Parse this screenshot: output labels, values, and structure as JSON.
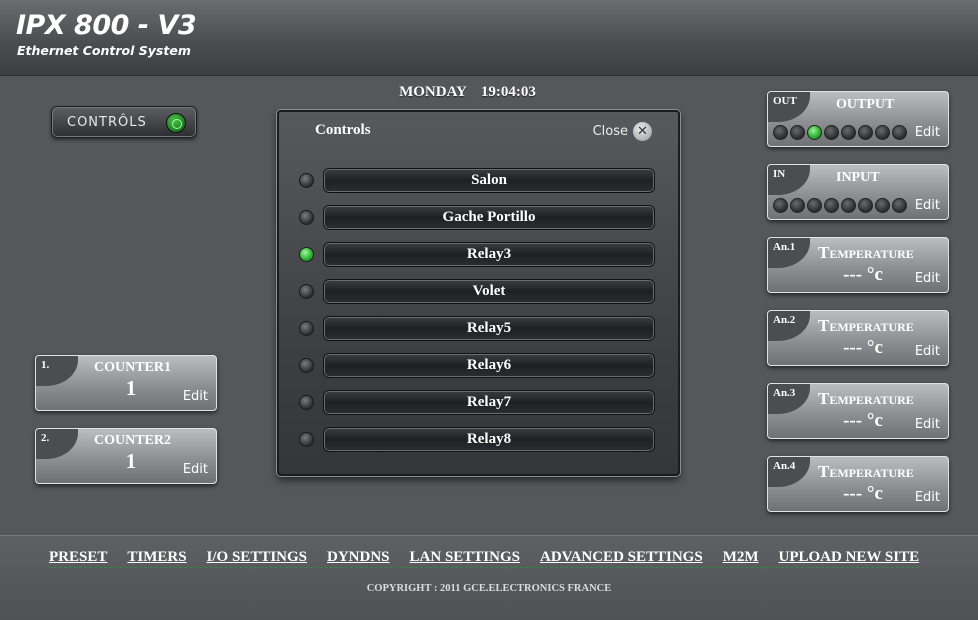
{
  "header": {
    "title": "IPX 800 - V3",
    "subtitle": "Ethernet Control System"
  },
  "datetime": {
    "day": "MONDAY",
    "time": "19:04:03"
  },
  "controls_button": {
    "label": "CONTRÔLS"
  },
  "counters": [
    {
      "index": "1.",
      "name": "COUNTER1",
      "value": "1",
      "edit": "Edit"
    },
    {
      "index": "2.",
      "name": "COUNTER2",
      "value": "1",
      "edit": "Edit"
    }
  ],
  "output": {
    "tab": "OUT",
    "title": "OUTPUT",
    "edit": "Edit",
    "leds": [
      false,
      false,
      true,
      false,
      false,
      false,
      false,
      false
    ]
  },
  "input": {
    "tab": "IN",
    "title": "INPUT",
    "edit": "Edit",
    "leds": [
      false,
      false,
      false,
      false,
      false,
      false,
      false,
      false
    ]
  },
  "analogs": [
    {
      "tab": "An.1",
      "title": "Temperature",
      "value": "--- °c",
      "edit": "Edit"
    },
    {
      "tab": "An.2",
      "title": "Temperature",
      "value": "--- °c",
      "edit": "Edit"
    },
    {
      "tab": "An.3",
      "title": "Temperature",
      "value": "--- °c",
      "edit": "Edit"
    },
    {
      "tab": "An.4",
      "title": "Temperature",
      "value": "--- °c",
      "edit": "Edit"
    }
  ],
  "panel": {
    "title": "Controls",
    "close_label": "Close",
    "close_icon": "close-icon",
    "relays": [
      {
        "label": "Salon",
        "on": false
      },
      {
        "label": "Gache Portillo",
        "on": false
      },
      {
        "label": "Relay3",
        "on": true
      },
      {
        "label": "Volet",
        "on": false
      },
      {
        "label": "Relay5",
        "on": false
      },
      {
        "label": "Relay6",
        "on": false
      },
      {
        "label": "Relay7",
        "on": false
      },
      {
        "label": "Relay8",
        "on": false
      }
    ]
  },
  "footer": {
    "nav": [
      "PRESET",
      "TIMERS",
      "I/O SETTINGS",
      "DYNDNS",
      "LAN SETTINGS",
      "ADVANCED SETTINGS",
      "M2M",
      "UPLOAD NEW SITE"
    ],
    "copyright": "COPYRIGHT : 2011 GCE.ELECTRONICS FRANCE"
  },
  "colors": {
    "led_on": "#2fb035",
    "background": "#56575b"
  }
}
